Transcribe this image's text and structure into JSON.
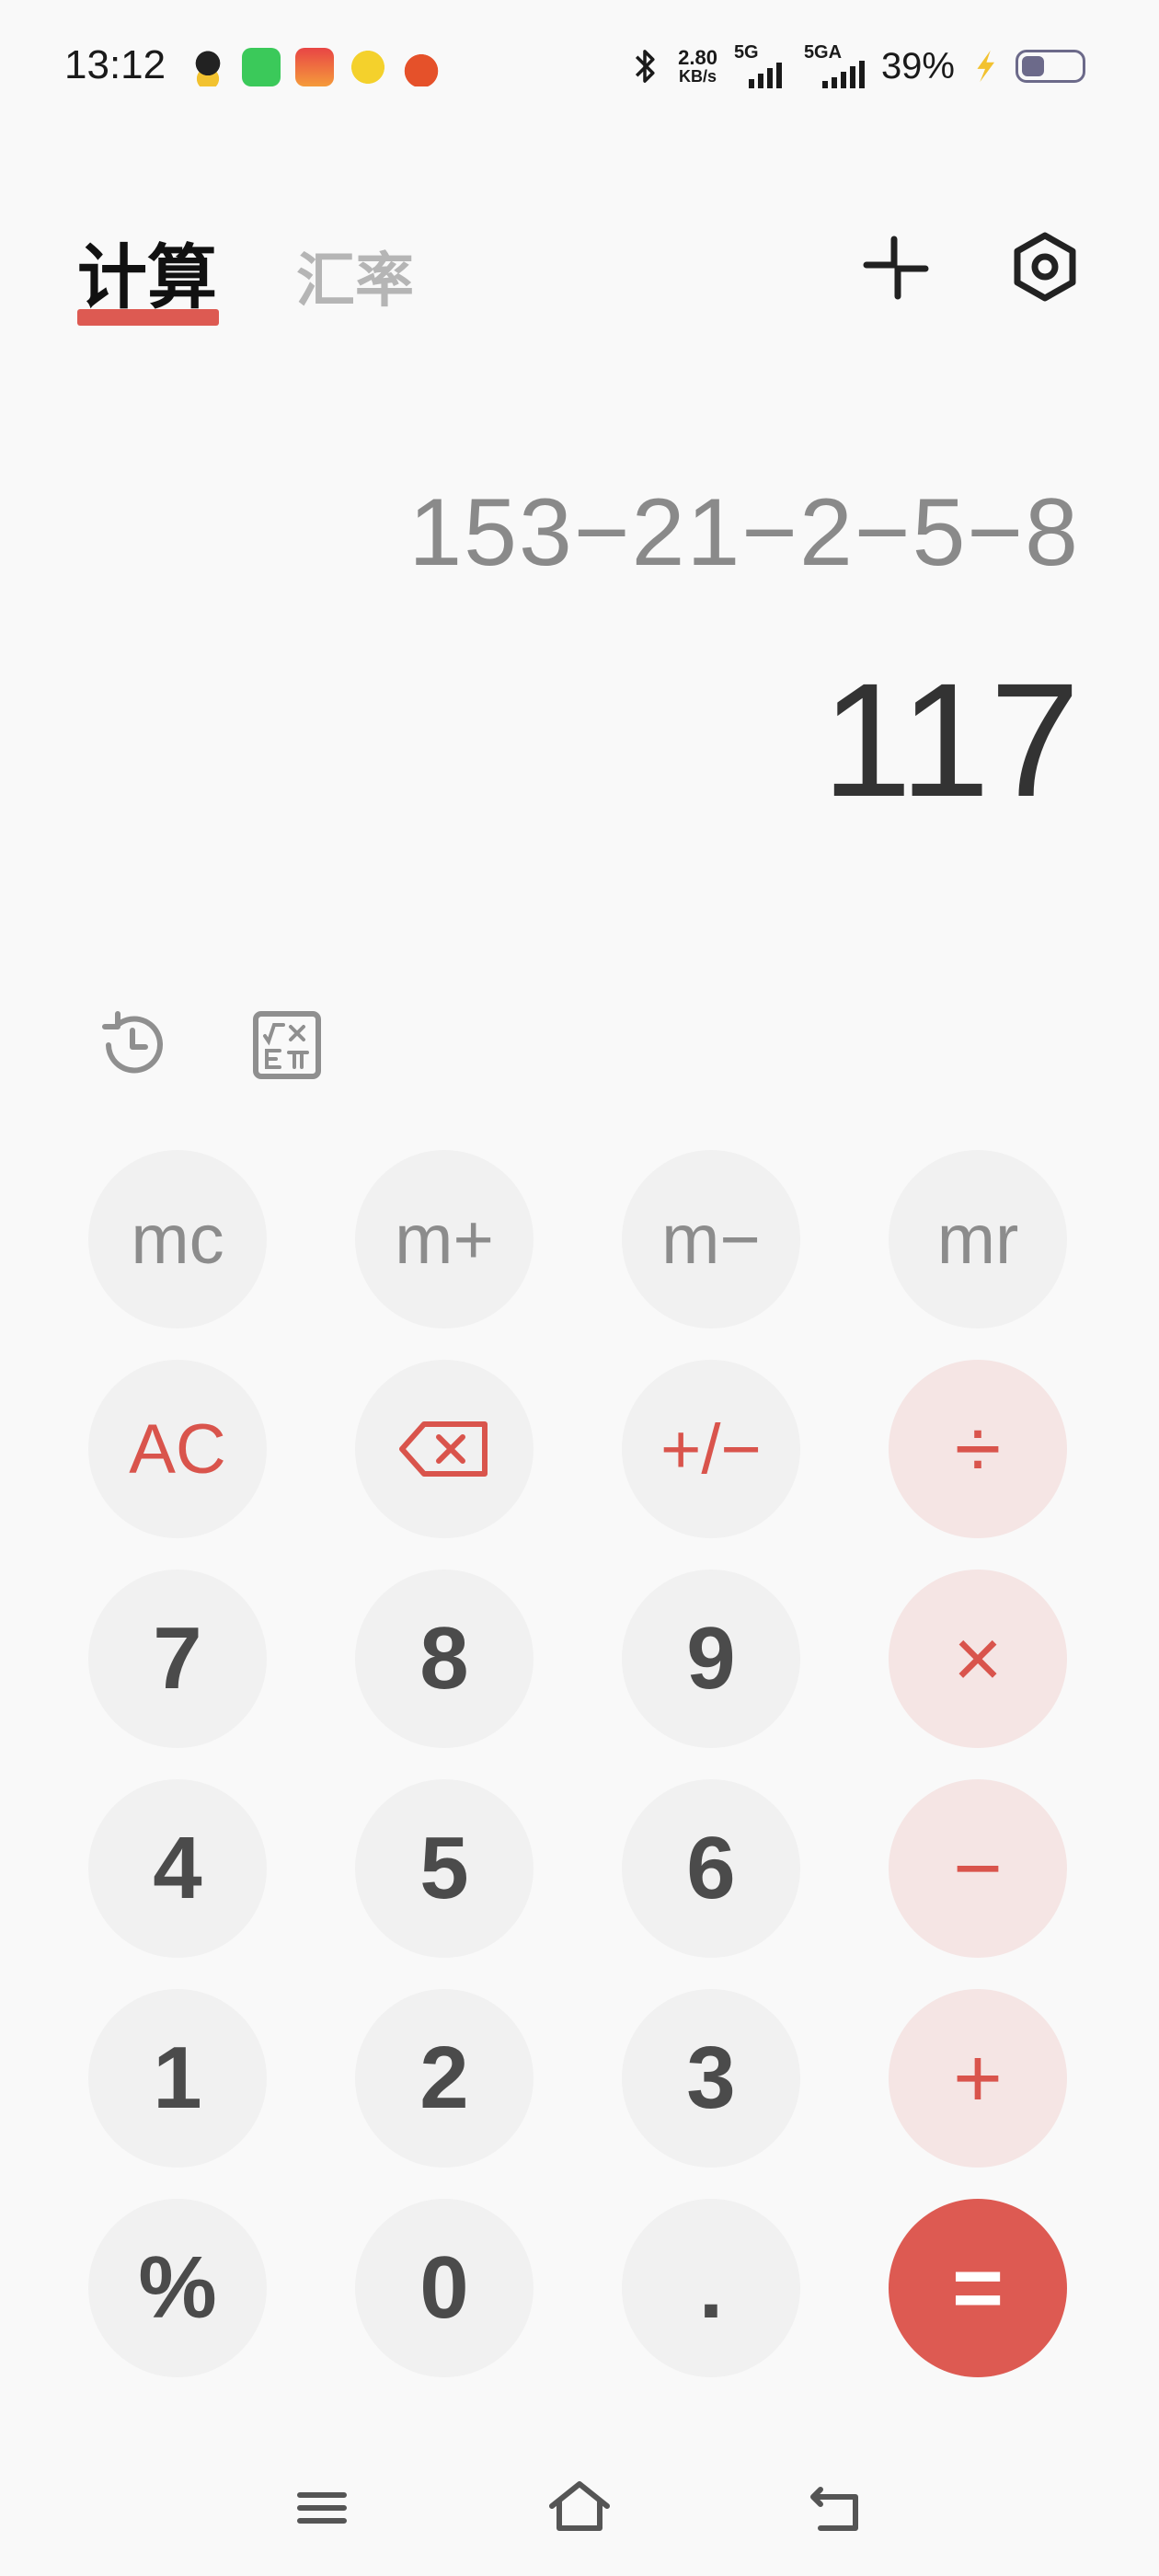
{
  "status_bar": {
    "time": "13:12",
    "net_speed": "2.80",
    "net_speed_unit": "KB/s",
    "sim1_label": "5G",
    "sim2_label": "5GA",
    "battery_percent": "39%",
    "battery_level": 0.39,
    "notification_icons": [
      "qq-icon",
      "wechat-icon",
      "game-app-icon",
      "yellow-app-icon",
      "red-app-icon"
    ]
  },
  "tabs": {
    "calculator": "计算",
    "exchange_rate": "汇率",
    "active": "calculator"
  },
  "display": {
    "expression": "153−21−2−5−8",
    "result": "117"
  },
  "keypad": {
    "rows": [
      [
        {
          "label": "mc",
          "type": "mem",
          "name": "mc-button"
        },
        {
          "label": "m+",
          "type": "mem",
          "name": "m-plus-button"
        },
        {
          "label": "m−",
          "type": "mem",
          "name": "m-minus-button"
        },
        {
          "label": "mr",
          "type": "mem",
          "name": "mr-button"
        }
      ],
      [
        {
          "label": "AC",
          "type": "func",
          "name": "clear-button"
        },
        {
          "label": "",
          "type": "func",
          "name": "backspace-button",
          "icon": "backspace-icon"
        },
        {
          "label": "+/−",
          "type": "func",
          "name": "sign-toggle-button"
        },
        {
          "label": "÷",
          "type": "op",
          "name": "divide-button"
        }
      ],
      [
        {
          "label": "7",
          "type": "num",
          "name": "digit-7-button"
        },
        {
          "label": "8",
          "type": "num",
          "name": "digit-8-button"
        },
        {
          "label": "9",
          "type": "num",
          "name": "digit-9-button"
        },
        {
          "label": "×",
          "type": "op",
          "name": "multiply-button"
        }
      ],
      [
        {
          "label": "4",
          "type": "num",
          "name": "digit-4-button"
        },
        {
          "label": "5",
          "type": "num",
          "name": "digit-5-button"
        },
        {
          "label": "6",
          "type": "num",
          "name": "digit-6-button"
        },
        {
          "label": "−",
          "type": "op",
          "name": "subtract-button"
        }
      ],
      [
        {
          "label": "1",
          "type": "num",
          "name": "digit-1-button"
        },
        {
          "label": "2",
          "type": "num",
          "name": "digit-2-button"
        },
        {
          "label": "3",
          "type": "num",
          "name": "digit-3-button"
        },
        {
          "label": "+",
          "type": "op",
          "name": "add-button"
        }
      ],
      [
        {
          "label": "%",
          "type": "num",
          "name": "percent-button"
        },
        {
          "label": "0",
          "type": "num",
          "name": "digit-0-button"
        },
        {
          "label": ".",
          "type": "num",
          "name": "decimal-button"
        },
        {
          "label": "=",
          "type": "eq",
          "name": "equals-button"
        }
      ]
    ]
  },
  "colors": {
    "accent": "#dd5a52",
    "operator_bg": "#f5e5e4",
    "key_bg": "#f1f1f1",
    "background": "#f9f9f9"
  },
  "icons": {
    "collapse": "collapse-icon",
    "settings": "settings-icon",
    "history": "history-icon",
    "scientific": "scientific-icon",
    "nav_menu": "menu-icon",
    "nav_home": "home-icon",
    "nav_back": "back-icon"
  }
}
